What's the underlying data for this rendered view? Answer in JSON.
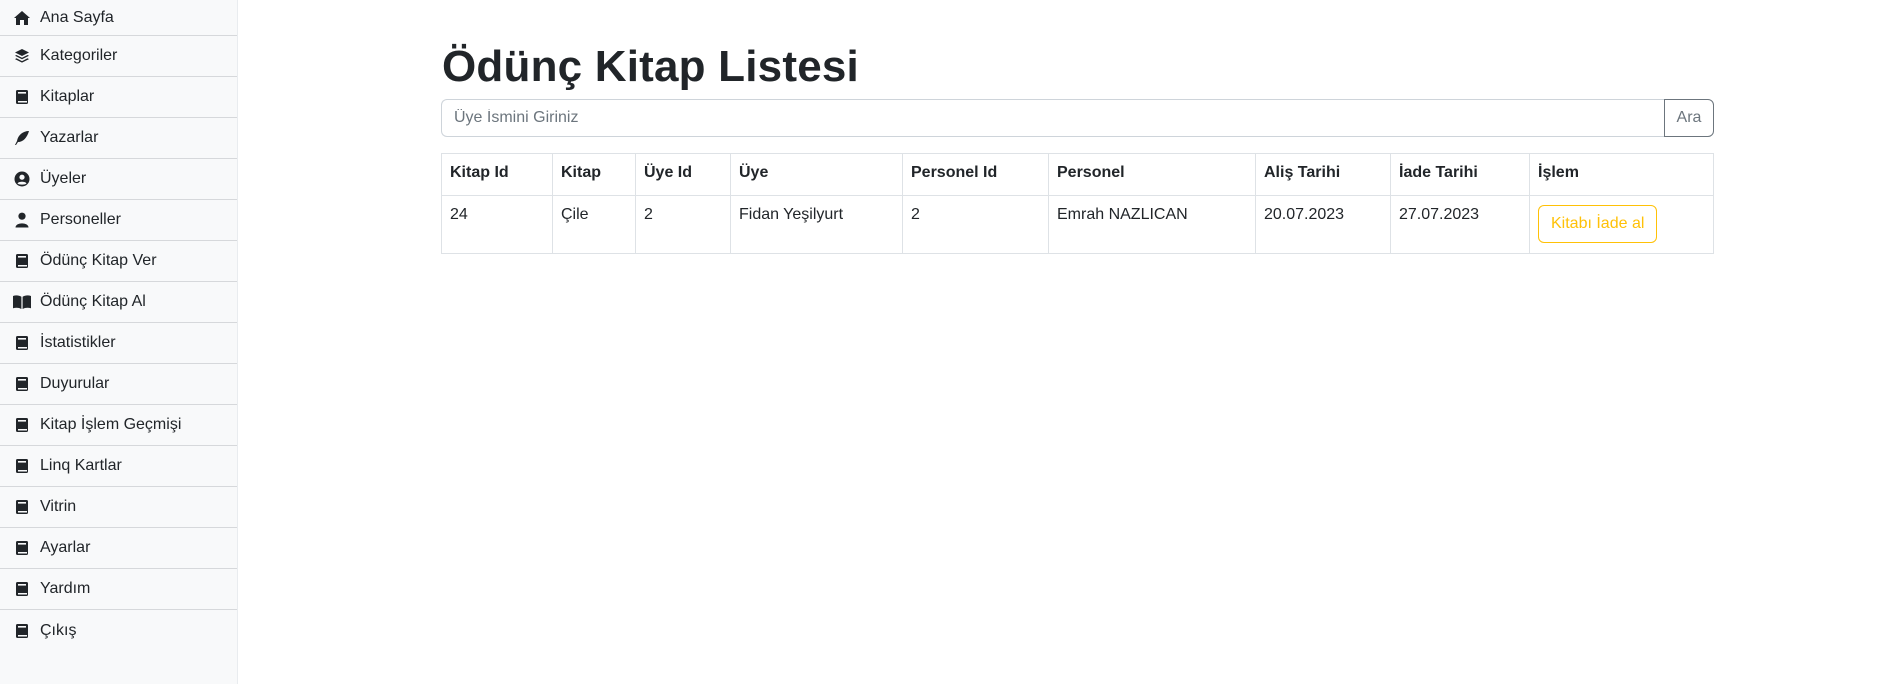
{
  "sidebar": {
    "items": [
      {
        "label": "Ana Sayfa",
        "icon": "home-icon"
      },
      {
        "label": "Kategoriler",
        "icon": "layers-icon"
      },
      {
        "label": "Kitaplar",
        "icon": "book-icon"
      },
      {
        "label": "Yazarlar",
        "icon": "feather-icon"
      },
      {
        "label": "Üyeler",
        "icon": "user-circle-icon"
      },
      {
        "label": "Personeller",
        "icon": "person-icon"
      },
      {
        "label": "Ödünç Kitap Ver",
        "icon": "book-icon"
      },
      {
        "label": "Ödünç Kitap Al",
        "icon": "book-open-icon"
      },
      {
        "label": "İstatistikler",
        "icon": "book-icon"
      },
      {
        "label": "Duyurular",
        "icon": "book-icon"
      },
      {
        "label": "Kitap İşlem Geçmişi",
        "icon": "book-icon"
      },
      {
        "label": "Linq Kartlar",
        "icon": "book-icon"
      },
      {
        "label": "Vitrin",
        "icon": "book-icon"
      },
      {
        "label": "Ayarlar",
        "icon": "book-icon"
      },
      {
        "label": "Yardım",
        "icon": "book-icon"
      },
      {
        "label": "Çıkış",
        "icon": "book-icon"
      }
    ]
  },
  "main": {
    "title": "Ödünç Kitap Listesi",
    "search": {
      "placeholder": "Üye İsmini Giriniz",
      "value": "",
      "button_label": "Ara"
    },
    "table": {
      "headers": [
        "Kitap Id",
        "Kitap",
        "Üye Id",
        "Üye",
        "Personel Id",
        "Personel",
        "Aliş Tarihi",
        "İade Tarihi",
        "İşlem"
      ],
      "rows": [
        {
          "cells": [
            "24",
            "Çile",
            "2",
            "Fidan Yeşilyurt",
            "2",
            "Emrah NAZLICAN",
            "20.07.2023",
            "27.07.2023"
          ],
          "action_label": "Kitabı İade al"
        }
      ]
    }
  },
  "colors": {
    "accent_warning": "#ffc107",
    "sidebar_bg": "#f8f9fa",
    "secondary": "#6c757d"
  }
}
